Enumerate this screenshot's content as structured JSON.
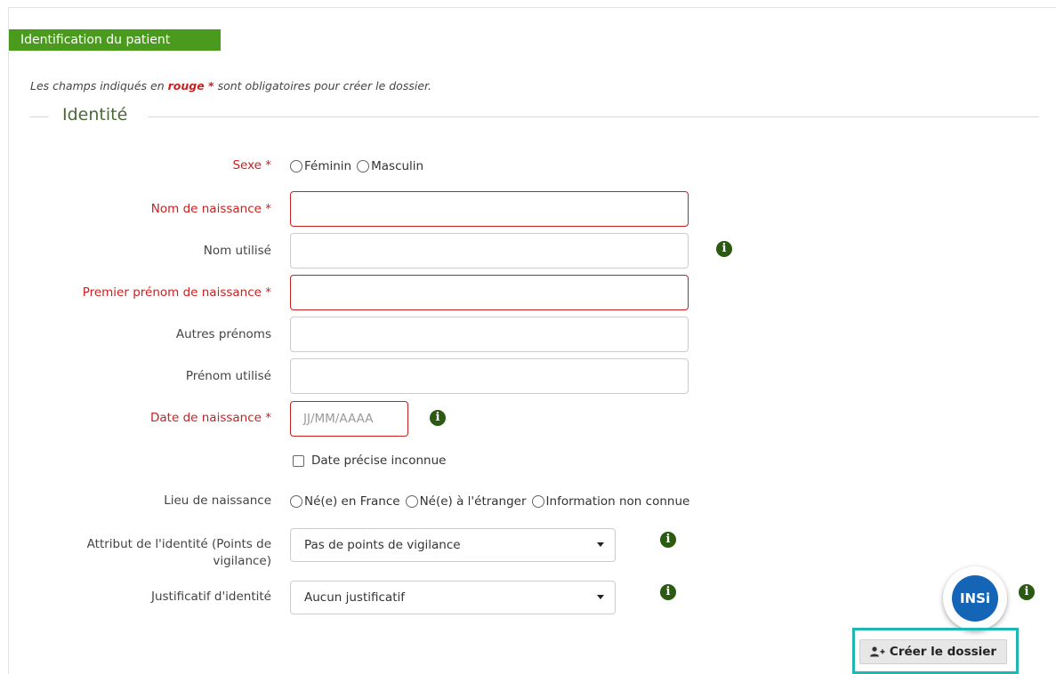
{
  "section": {
    "title": "Identification du patient"
  },
  "note": {
    "before": "Les champs indiqués en ",
    "rouge": "rouge",
    "star": " *",
    "after": " sont obligatoires pour créer le dossier."
  },
  "fieldset": {
    "legend": "Identité"
  },
  "fields": {
    "sexe": {
      "label": "Sexe *",
      "options": [
        "Féminin",
        "Masculin"
      ]
    },
    "nom_naissance": {
      "label": "Nom de naissance *",
      "value": ""
    },
    "nom_utilise": {
      "label": "Nom utilisé",
      "value": ""
    },
    "premier_prenom": {
      "label": "Premier prénom de naissance *",
      "value": ""
    },
    "autres_prenoms": {
      "label": "Autres prénoms",
      "value": ""
    },
    "prenom_utilise": {
      "label": "Prénom utilisé",
      "value": ""
    },
    "date_naissance": {
      "label": "Date de naissance *",
      "placeholder": "JJ/MM/AAAA"
    },
    "date_inconnue": {
      "label": "Date précise inconnue"
    },
    "lieu_naissance": {
      "label": "Lieu de naissance",
      "options": [
        "Né(e) en France",
        "Né(e) à l'étranger",
        "Information non connue"
      ]
    },
    "attribut": {
      "label_line1": "Attribut de l'identité (Points de",
      "label_line2": "vigilance)",
      "selected": "Pas de points de vigilance"
    },
    "justificatif": {
      "label": "Justificatif d'identité",
      "selected": "Aucun justificatif"
    }
  },
  "badge": {
    "text": "INSi"
  },
  "actions": {
    "create_label": "Créer le dossier"
  },
  "colors": {
    "accent_green": "#4a9a1e",
    "required_red": "#cc1f1f",
    "info_green": "#2b5a12",
    "focus_teal": "#1fb6b4"
  },
  "icons": {
    "info": "info-circle-icon",
    "create": "user-plus-icon"
  }
}
